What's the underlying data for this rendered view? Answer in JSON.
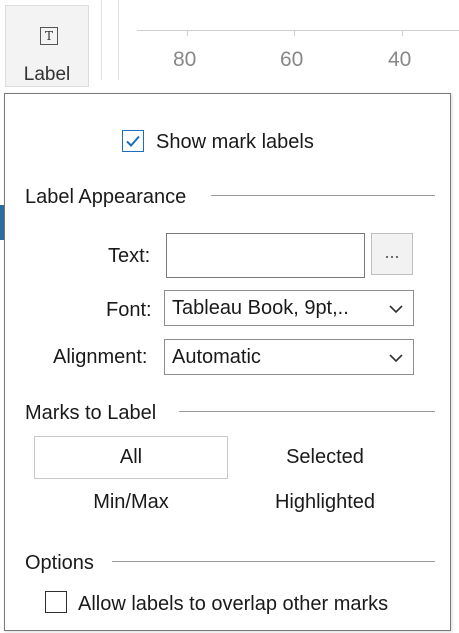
{
  "marks_card": {
    "label_button": "Label",
    "label_icon_glyph": "T"
  },
  "axis": {
    "ticks": [
      "80",
      "60",
      "40"
    ]
  },
  "popup": {
    "show_mark_labels": {
      "label": "Show mark labels",
      "checked": true
    },
    "label_appearance": {
      "heading": "Label Appearance",
      "text_label": "Text:",
      "text_value": "",
      "ellipsis_button": "...",
      "font_label": "Font:",
      "font_value": "Tableau Book, 9pt,..",
      "alignment_label": "Alignment:",
      "alignment_value": "Automatic"
    },
    "marks_to_label": {
      "heading": "Marks to Label",
      "options": [
        "All",
        "Selected",
        "Min/Max",
        "Highlighted"
      ],
      "selected": "All"
    },
    "options": {
      "heading": "Options",
      "allow_overlap": {
        "label": "Allow labels to overlap other marks",
        "checked": false
      }
    }
  },
  "colors": {
    "checkbox_checked": "#1b6fc0",
    "accent_bar": "#2a6fa0"
  }
}
